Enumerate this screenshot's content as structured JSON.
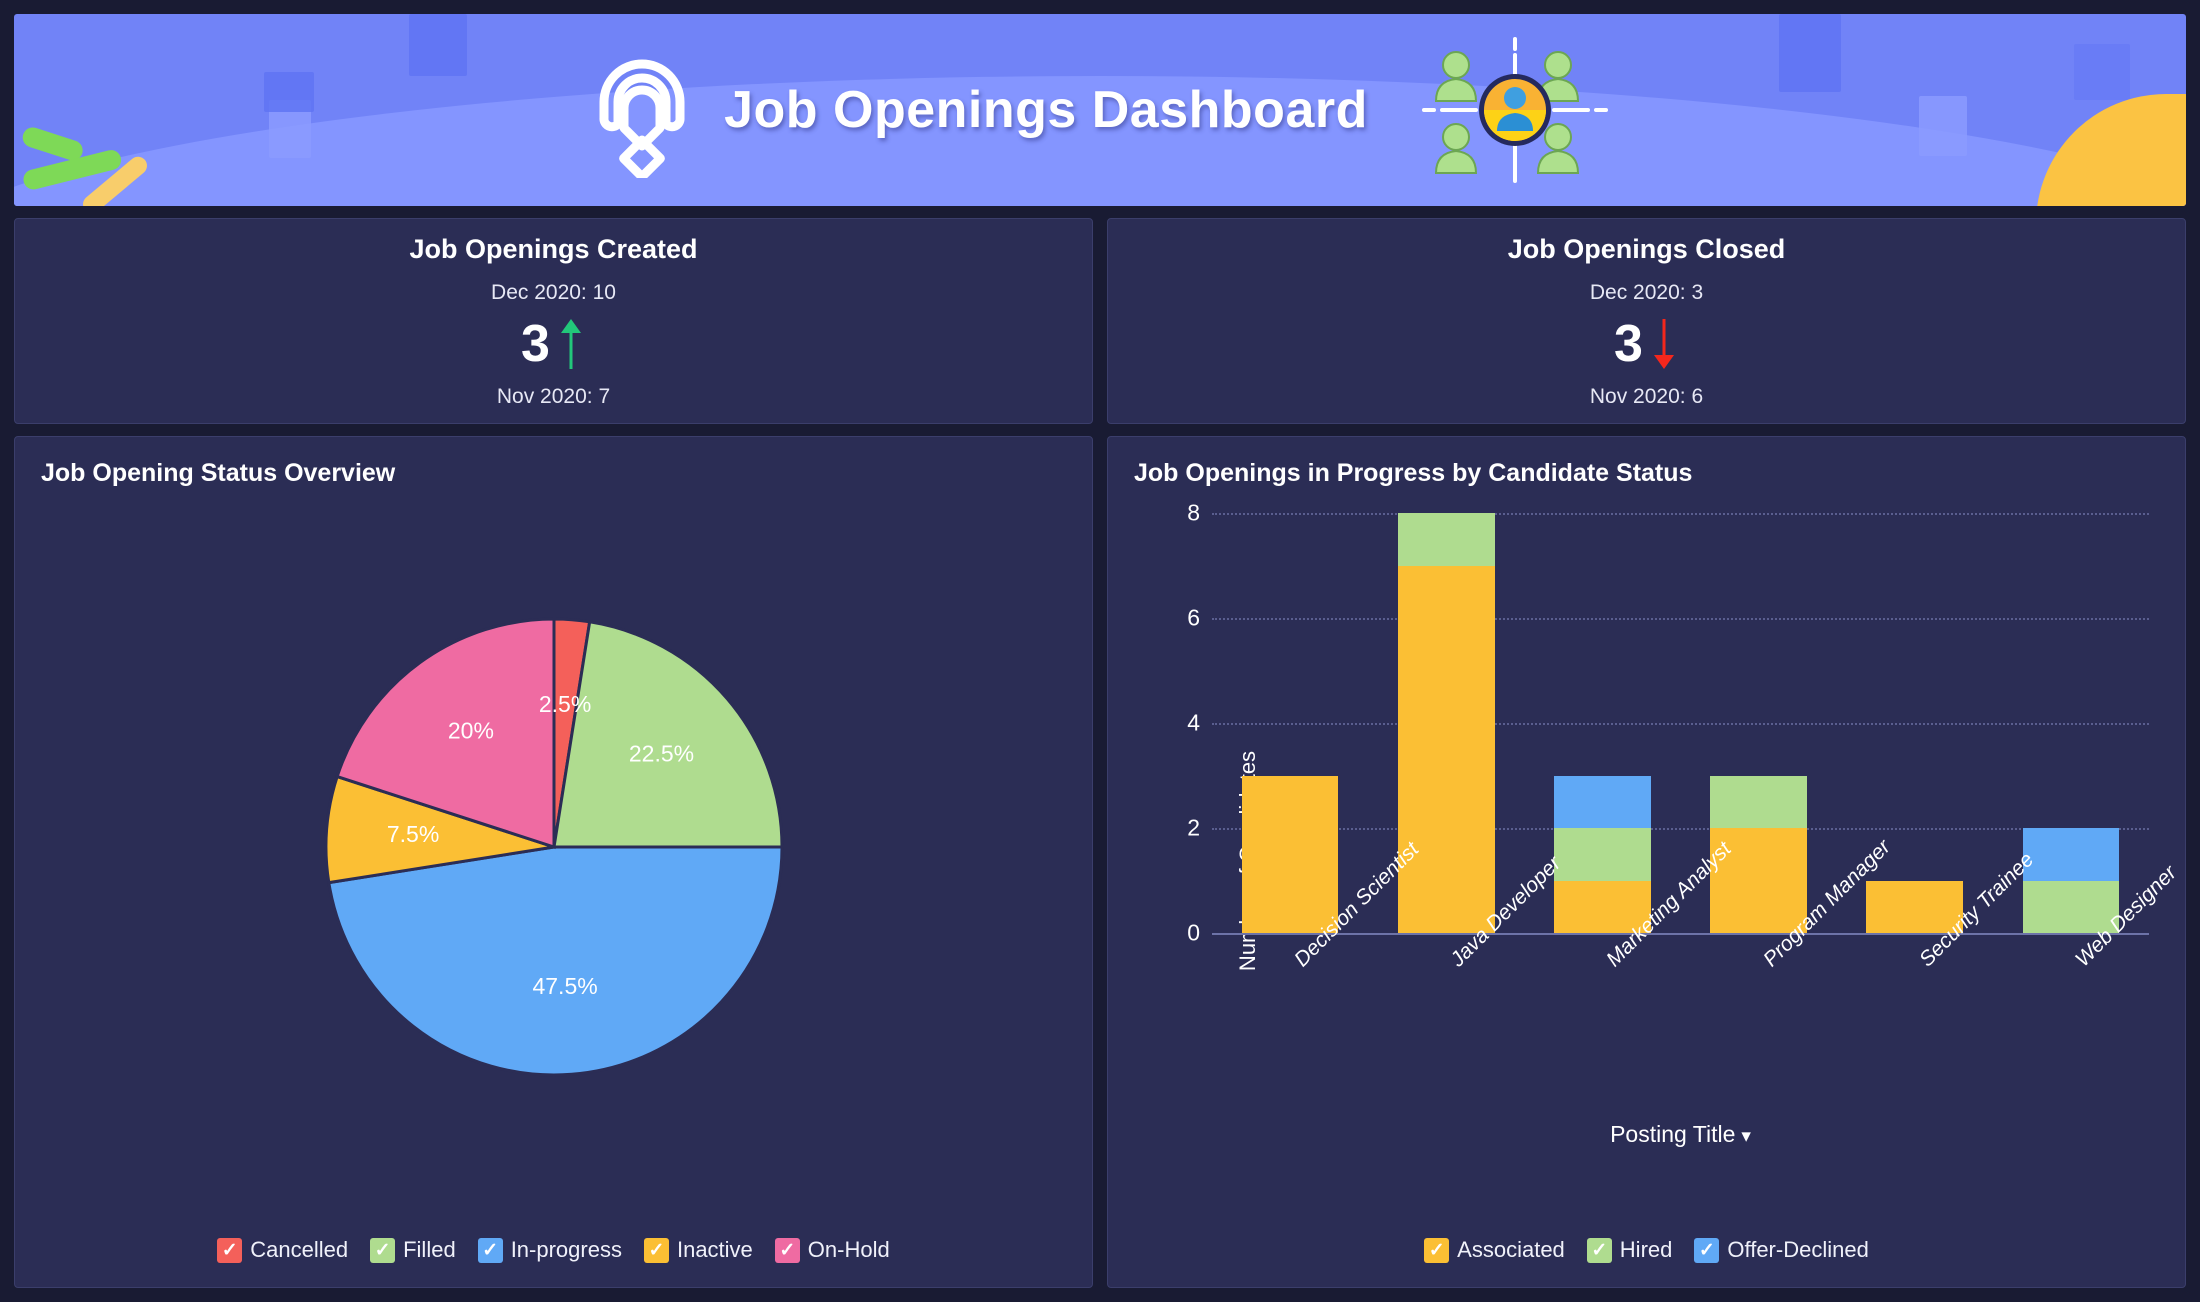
{
  "header": {
    "title": "Job Openings Dashboard",
    "logo_icon": "zoho-recruit-logo-icon",
    "people_icon": "people-target-icon",
    "background_color": "#7183f7"
  },
  "kpis": [
    {
      "title": "Job Openings Created",
      "current_label": "Dec 2020: 10",
      "delta_value": "3",
      "trend": "up",
      "trend_icon": "arrow-up-icon",
      "trend_color": "#22c77a",
      "previous_label": "Nov 2020: 7"
    },
    {
      "title": "Job Openings Closed",
      "current_label": "Dec 2020: 3",
      "delta_value": "3",
      "trend": "down",
      "trend_icon": "arrow-down-icon",
      "trend_color": "#f4271c",
      "previous_label": "Nov 2020: 6"
    }
  ],
  "panels": {
    "pie_panel_title": "Job Opening Status Overview",
    "bar_panel_title": "Job Openings in Progress by Candidate Status"
  },
  "chart_data": [
    {
      "type": "pie",
      "title": "Job Opening Status Overview",
      "labels": [
        "Cancelled",
        "Filled",
        "In-progress",
        "Inactive",
        "On-Hold"
      ],
      "values": [
        2.5,
        22.5,
        47.5,
        7.5,
        20
      ],
      "value_labels": [
        "2.5%",
        "22.5%",
        "47.5%",
        "7.5%",
        "20%"
      ],
      "colors": [
        "#f4605a",
        "#afdc8f",
        "#60a9f6",
        "#fbbf34",
        "#ef6ba2"
      ],
      "legend_position": "bottom",
      "start_angle_deg": 0,
      "direction": "clockwise"
    },
    {
      "type": "bar",
      "subtype": "stacked",
      "title": "Job Openings in Progress by Candidate Status",
      "xlabel": "Posting Title",
      "ylabel": "Number of Candidates",
      "categories": [
        "Decision Scientist",
        "Java Developer",
        "Marketing Analyst",
        "Program Manager",
        "Security Trainee",
        "Web Designer"
      ],
      "series": [
        {
          "name": "Associated",
          "color": "#fbbf34",
          "values": [
            3,
            7,
            1,
            2,
            1,
            0
          ]
        },
        {
          "name": "Hired",
          "color": "#afdc8f",
          "values": [
            0,
            1,
            1,
            1,
            0,
            1
          ]
        },
        {
          "name": "Offer-Declined",
          "color": "#60a9f6",
          "values": [
            0,
            0,
            1,
            0,
            0,
            1
          ]
        }
      ],
      "totals": [
        3,
        8,
        3,
        3,
        1,
        2
      ],
      "yticks": [
        0,
        2,
        4,
        6,
        8
      ],
      "ylim": [
        0,
        8
      ],
      "grid": true,
      "legend_position": "bottom",
      "xaxis_dropdown_icon": "chevron-down-icon"
    }
  ],
  "pie_legend": [
    {
      "label": "Cancelled",
      "color": "#f4605a",
      "checked": true,
      "check": "✓"
    },
    {
      "label": "Filled",
      "color": "#afdc8f",
      "checked": true,
      "check": "✓"
    },
    {
      "label": "In-progress",
      "color": "#60a9f6",
      "checked": true,
      "check": "✓"
    },
    {
      "label": "Inactive",
      "color": "#fbbf34",
      "checked": true,
      "check": "✓"
    },
    {
      "label": "On-Hold",
      "color": "#ef6ba2",
      "checked": true,
      "check": "✓"
    }
  ],
  "bar_legend": [
    {
      "label": "Associated",
      "color": "#fbbf34",
      "checked": true,
      "check": "✓"
    },
    {
      "label": "Hired",
      "color": "#afdc8f",
      "checked": true,
      "check": "✓"
    },
    {
      "label": "Offer-Declined",
      "color": "#60a9f6",
      "checked": true,
      "check": "✓"
    }
  ],
  "bar_axis": {
    "ylabel": "Number of Candidates",
    "xlabel": "Posting Title",
    "yticks": [
      "8",
      "6",
      "4",
      "2",
      "0"
    ]
  },
  "theme": {
    "page_bg": "#191b33",
    "panel_bg": "#2b2d55",
    "panel_border": "#3b3e6b",
    "text": "#ffffff"
  }
}
